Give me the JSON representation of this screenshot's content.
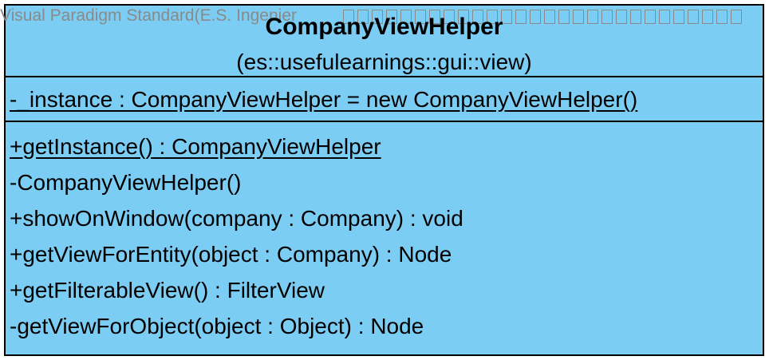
{
  "watermark": {
    "text": "Visual Paradigm Standard(E.S. Ingenier"
  },
  "class": {
    "name": "CompanyViewHelper",
    "package": "(es::usefulearnings::gui::view)",
    "attributes": [
      {
        "text": "-_instance : CompanyViewHelper = new CompanyViewHelper()",
        "static": true
      }
    ],
    "operations": [
      {
        "text": "+getInstance() : CompanyViewHelper",
        "static": true
      },
      {
        "text": "-CompanyViewHelper()",
        "static": false
      },
      {
        "text": "+showOnWindow(company : Company) : void",
        "static": false
      },
      {
        "text": "+getViewForEntity(object : Company) : Node",
        "static": false
      },
      {
        "text": "+getFilterableView() : FilterView",
        "static": false
      },
      {
        "text": "-getViewForObject(object : Object) : Node",
        "static": false
      }
    ]
  },
  "colors": {
    "class_fill": "#7ccdf4",
    "border": "#000000",
    "watermark": "#8a8a8a"
  }
}
